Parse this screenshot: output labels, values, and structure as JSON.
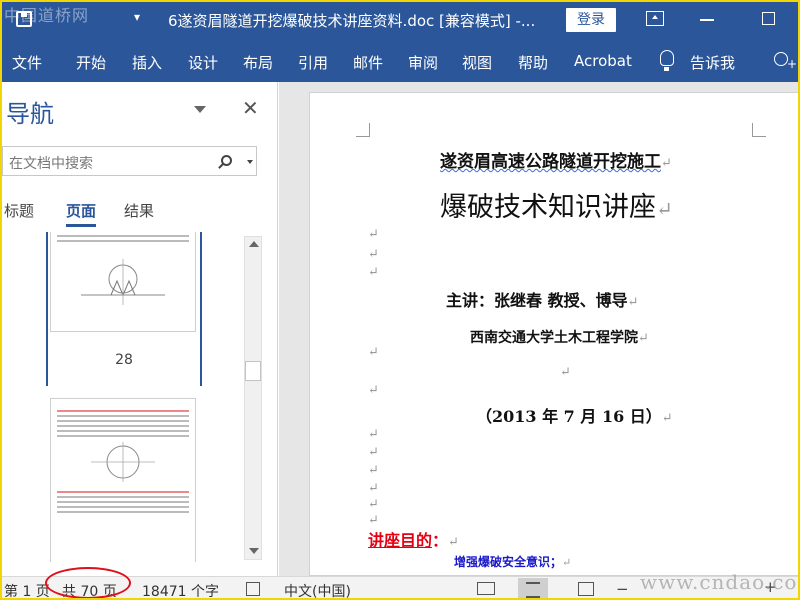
{
  "titlebar": {
    "watermark": "中国道桥网",
    "doc_title": "6遂资眉隧道开挖爆破技术讲座资料.doc [兼容模式] -...",
    "qat_more": "▾",
    "login_label": "登录"
  },
  "ribbon": {
    "tabs": [
      "文件",
      "开始",
      "插入",
      "设计",
      "布局",
      "引用",
      "邮件",
      "审阅",
      "视图",
      "帮助",
      "Acrobat"
    ],
    "tell_me": "告诉我"
  },
  "nav": {
    "title": "导航",
    "close": "✕",
    "search_placeholder": "在文档中搜索",
    "tabs": [
      {
        "label": "标题",
        "active": false
      },
      {
        "label": "页面",
        "active": true
      },
      {
        "label": "结果",
        "active": false
      }
    ],
    "thumbnails": [
      {
        "page": "28",
        "selected": true
      },
      {
        "page": "",
        "selected": false
      }
    ]
  },
  "document": {
    "heading_small": "遂资眉高速公路隧道开挖施工",
    "heading_big": "爆破技术知识讲座",
    "lecturer": "主讲：张继春      教授、博导",
    "school": "西南交通大学土木工程学院",
    "date": "（2013 年 7 月 16 日）",
    "purpose_label": "讲座目的",
    "purpose_colon": "：",
    "goal": "增强爆破安全意识；",
    "paragraph_mark": "↵"
  },
  "statusbar": {
    "page": "第 1 页",
    "total_pages": "共 70 页",
    "word_count": "18471 个字",
    "language": "中文(中国)",
    "zoom_minus": "−",
    "zoom_plus": "+",
    "watermark": "www.cndao.com"
  },
  "colors": {
    "accent": "#2b579a",
    "highlight_red": "#e0101a",
    "frame": "#f2d600",
    "purpose_red": "#e60012",
    "goal_blue": "#1a1ac8"
  },
  "icons": [
    "save-icon",
    "ribbon-display-icon",
    "minimize-icon",
    "maximize-icon",
    "lightbulb-icon",
    "share-icon",
    "menu-chevron-icon",
    "close-icon",
    "search-icon",
    "macro-icon",
    "read-mode-icon",
    "print-layout-icon",
    "web-layout-icon"
  ]
}
